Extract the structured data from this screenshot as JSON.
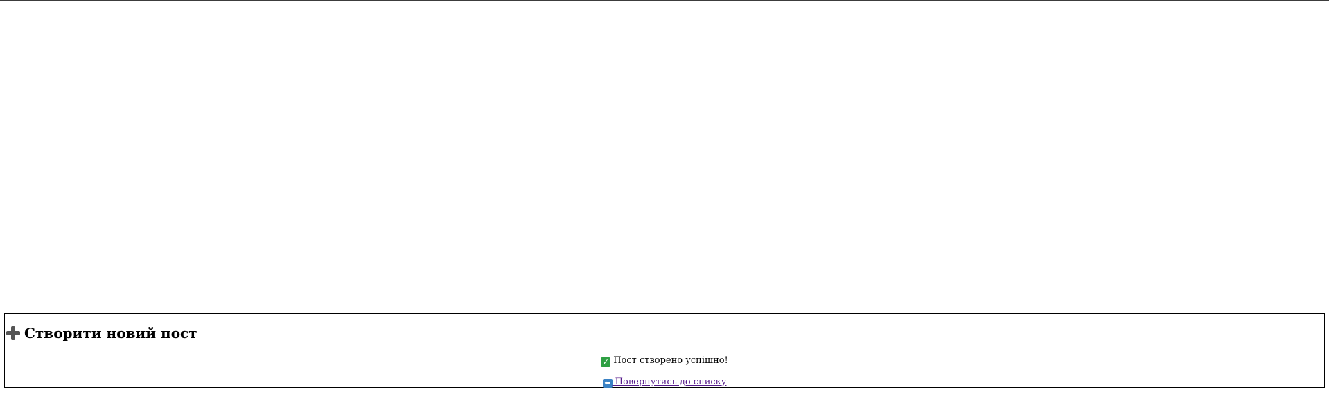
{
  "page": {
    "heading": "Створити новий пост",
    "heading_icon": "plus-icon",
    "success_message": "Пост створено успішно!",
    "success_icon": "check-mark-icon",
    "back_link_label": "Повернутись до списку",
    "back_link_icon": "back-arrow-icon"
  },
  "colors": {
    "link_visited": "#551a8b",
    "success_green": "#2ea043",
    "border": "#000000"
  }
}
